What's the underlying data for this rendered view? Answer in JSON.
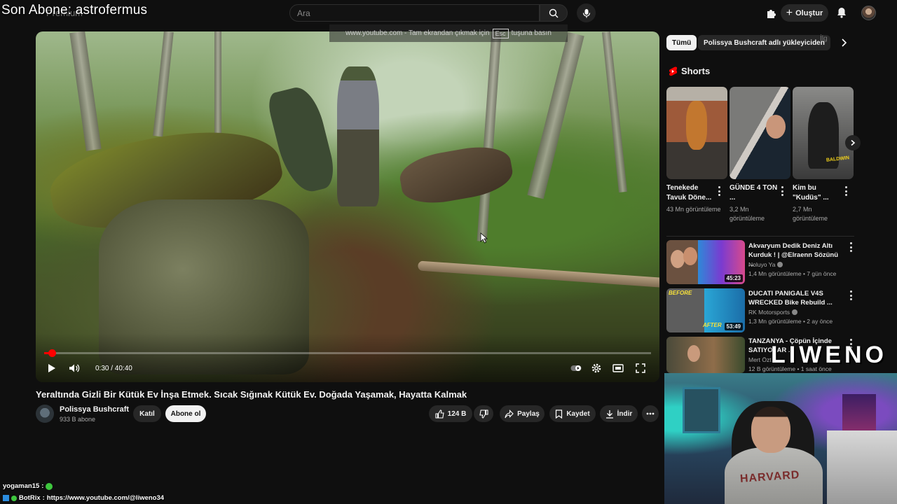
{
  "overlay": {
    "stream_title": "Son Abone: astrofermus",
    "brand": "LIWENO"
  },
  "topbar": {
    "logo_text": "Premium",
    "search_placeholder": "Ara",
    "create_label": "Oluştur"
  },
  "player": {
    "fullscreen_hint_prefix": "www.youtube.com - Tam ekrandan çıkmak için",
    "fullscreen_hint_key": "Esc",
    "fullscreen_hint_suffix": "tuşuna basın",
    "time_display": "0:30 / 40:40",
    "progress": 0.0123
  },
  "video": {
    "title": "Yeraltında Gizli Bir Kütük Ev İnşa Etmek. Sıcak Sığınak Kütük Ev. Doğada Yaşamak, Hayatta Kalmak",
    "channel_name": "Polissya Bushcraft",
    "subscribers": "933 B abone",
    "join_label": "Katıl",
    "subscribe_label": "Abone ol",
    "like_count": "124 B",
    "share_label": "Paylaş",
    "save_label": "Kaydet",
    "download_label": "İndir"
  },
  "sidebar": {
    "chips": [
      "Tümü",
      "Polissya Bushcraft adlı yükleyiciden"
    ],
    "chip_overflow": "İlg",
    "shorts_heading": "Shorts",
    "shorts": [
      {
        "title": "Tenekede Tavuk Döne...",
        "views": "43 Mn görüntüleme"
      },
      {
        "title": "GÜNDE 4 TON ...",
        "views": "3,2 Mn görüntüleme"
      },
      {
        "title": "Kim bu \"Kudüs\" ...",
        "views": "2,7 Mn görüntüleme"
      }
    ],
    "short_badge": "BALDWIN",
    "recommendations": [
      {
        "title": "Akvaryum Dedik Deniz Altı Kurduk ! | @Elraenn Sözünü ...",
        "channel": "Noluyo Ya",
        "verified": true,
        "meta": "1,4 Mn görüntüleme • 7 gün önce",
        "duration": "45:23"
      },
      {
        "title": "DUCATI PANIGALE V4S WRECKED Bike Rebuild ...",
        "channel": "RK Motorsports",
        "verified": true,
        "meta": "1,3 Mn görüntüleme • 2 ay önce",
        "duration": "53:49",
        "thumb_tag_top": "BEFORE",
        "thumb_tag_bottom": "AFTER"
      },
      {
        "title": "TANZANYA - Çöpün İçinde SATIYOLAR ...",
        "channel": "Mert Özt",
        "verified": false,
        "meta": "12 B görüntüleme • 1 saat önce",
        "duration": ""
      }
    ]
  },
  "webcam": {
    "hoodie_text": "HARVARD"
  },
  "chat": [
    {
      "user": "yogaman15",
      "message": ":"
    },
    {
      "user": "BotRix",
      "message": "https://www.youtube.com/@liweno34"
    }
  ],
  "colors": {
    "background": "#0f0f0f",
    "accent_red": "#ff0000",
    "chip_bg": "#272727",
    "text_primary": "#f1f1f1",
    "text_secondary": "#aaaaaa"
  }
}
